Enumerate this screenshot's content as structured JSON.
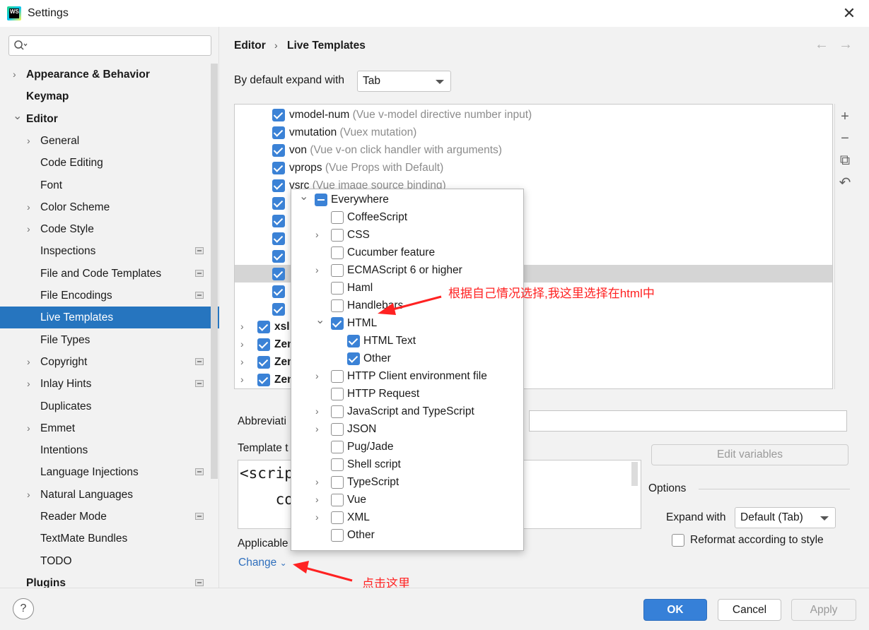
{
  "window": {
    "title": "Settings",
    "app_icon": "WS"
  },
  "sidebar": {
    "search_placeholder": "",
    "items": [
      {
        "label": "Appearance & Behavior",
        "bold": true,
        "arrow": "collapsed"
      },
      {
        "label": "Keymap",
        "bold": true
      },
      {
        "label": "Editor",
        "bold": true,
        "arrow": "expanded"
      },
      {
        "label": "General",
        "arrow": "collapsed"
      },
      {
        "label": "Code Editing"
      },
      {
        "label": "Font"
      },
      {
        "label": "Color Scheme",
        "arrow": "collapsed"
      },
      {
        "label": "Code Style",
        "arrow": "collapsed"
      },
      {
        "label": "Inspections",
        "badge": true
      },
      {
        "label": "File and Code Templates",
        "badge": true
      },
      {
        "label": "File Encodings",
        "badge": true
      },
      {
        "label": "Live Templates",
        "selected": true
      },
      {
        "label": "File Types"
      },
      {
        "label": "Copyright",
        "arrow": "collapsed",
        "badge": true
      },
      {
        "label": "Inlay Hints",
        "arrow": "collapsed",
        "badge": true
      },
      {
        "label": "Duplicates"
      },
      {
        "label": "Emmet",
        "arrow": "collapsed"
      },
      {
        "label": "Intentions"
      },
      {
        "label": "Language Injections",
        "badge": true
      },
      {
        "label": "Natural Languages",
        "arrow": "collapsed"
      },
      {
        "label": "Reader Mode",
        "badge": true
      },
      {
        "label": "TextMate Bundles"
      },
      {
        "label": "TODO"
      },
      {
        "label": "Plugins",
        "bold": true,
        "badge": true
      }
    ]
  },
  "breadcrumb": {
    "parent": "Editor",
    "separator": "›",
    "current": "Live Templates",
    "back": "←",
    "forward": "→"
  },
  "expand": {
    "label": "By default expand with",
    "value": "Tab"
  },
  "templates": [
    {
      "name": "vmodel-num",
      "desc": "(Vue v-model directive number input)",
      "checked": true
    },
    {
      "name": "vmutation",
      "desc": "(Vuex mutation)",
      "checked": true
    },
    {
      "name": "von",
      "desc": "(Vue v-on click handler with arguments)",
      "checked": true
    },
    {
      "name": "vprops",
      "desc": "(Vue Props with Default)",
      "checked": true
    },
    {
      "name": "vsrc",
      "desc": "(Vue image source binding)",
      "checked": true
    },
    {
      "name": "",
      "desc": "",
      "checked": true
    },
    {
      "name": "",
      "desc": "",
      "checked": true
    },
    {
      "name": "",
      "desc": "",
      "checked": true
    },
    {
      "name": "",
      "desc": "",
      "checked": true
    },
    {
      "name": "",
      "desc": "",
      "checked": true,
      "highlight": true
    },
    {
      "name": "",
      "desc": "",
      "checked": true
    },
    {
      "name": "",
      "desc": "",
      "checked": true
    },
    {
      "name": "xsl",
      "desc": "",
      "checked": true,
      "group": true
    },
    {
      "name": "Zen",
      "desc": "",
      "checked": true,
      "group": true
    },
    {
      "name": "Zen",
      "desc": "",
      "checked": true,
      "group": true
    },
    {
      "name": "Zen",
      "desc": "",
      "checked": true,
      "group": true
    }
  ],
  "list_tools": [
    "+",
    "−",
    "⧉",
    "↶"
  ],
  "details": {
    "abbreviation_label": "Abbreviati",
    "abbreviation_value": "",
    "template_label": "Template t",
    "template_lines": [
      "<scrip",
      "    co"
    ],
    "edit_variables": "Edit variables",
    "options_label": "Options",
    "expand_with_label": "Expand with",
    "expand_with_value": "Default (Tab)",
    "reformat_label": "Reformat according to style",
    "applicable_label": "Applicable",
    "change_link": "Change",
    "change_caret": "⌄"
  },
  "popup": {
    "rows": [
      {
        "label": "Everywhere",
        "state": "partial",
        "arrow": "expanded",
        "level": 0
      },
      {
        "label": "CoffeeScript",
        "state": "off",
        "level": 1
      },
      {
        "label": "CSS",
        "state": "off",
        "arrow": "collapsed",
        "level": 1
      },
      {
        "label": "Cucumber feature",
        "state": "off",
        "level": 1
      },
      {
        "label": "ECMAScript 6 or higher",
        "state": "off",
        "arrow": "collapsed",
        "level": 1
      },
      {
        "label": "Haml",
        "state": "off",
        "level": 1
      },
      {
        "label": "Handlebars",
        "state": "off",
        "level": 1
      },
      {
        "label": "HTML",
        "state": "on",
        "arrow": "expanded",
        "level": 1
      },
      {
        "label": "HTML Text",
        "state": "on",
        "level": 2
      },
      {
        "label": "Other",
        "state": "on",
        "level": 2
      },
      {
        "label": "HTTP Client environment file",
        "state": "off",
        "arrow": "collapsed",
        "level": 1
      },
      {
        "label": "HTTP Request",
        "state": "off",
        "level": 1
      },
      {
        "label": "JavaScript and TypeScript",
        "state": "off",
        "arrow": "collapsed",
        "level": 1
      },
      {
        "label": "JSON",
        "state": "off",
        "arrow": "collapsed",
        "level": 1
      },
      {
        "label": "Pug/Jade",
        "state": "off",
        "level": 1
      },
      {
        "label": "Shell script",
        "state": "off",
        "level": 1
      },
      {
        "label": "TypeScript",
        "state": "off",
        "arrow": "collapsed",
        "level": 1
      },
      {
        "label": "Vue",
        "state": "off",
        "arrow": "collapsed",
        "level": 1
      },
      {
        "label": "XML",
        "state": "off",
        "arrow": "collapsed",
        "level": 1
      },
      {
        "label": "Other",
        "state": "off",
        "level": 1
      }
    ]
  },
  "annotations": {
    "html_note": "根据自己情况选择,我这里选择在html中",
    "change_note": "点击这里",
    "color": "#ff2222"
  },
  "footer": {
    "help": "?",
    "ok": "OK",
    "cancel": "Cancel",
    "apply": "Apply"
  }
}
